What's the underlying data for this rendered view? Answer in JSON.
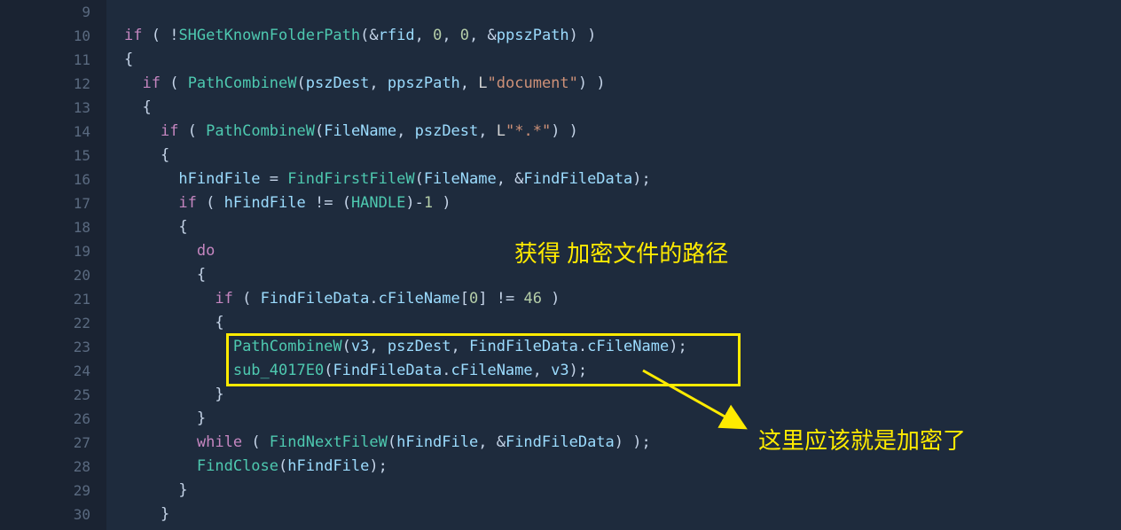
{
  "lines": [
    {
      "num": "9",
      "bp": false,
      "tokens": []
    },
    {
      "num": "10",
      "bp": true,
      "tokens": [
        {
          "t": "if",
          "c": "kw"
        },
        {
          "t": " ( !",
          "c": "punc"
        },
        {
          "t": "SHGetKnownFolderPath",
          "c": "func"
        },
        {
          "t": "(&",
          "c": "punc"
        },
        {
          "t": "rfid",
          "c": "var"
        },
        {
          "t": ", ",
          "c": "punc"
        },
        {
          "t": "0",
          "c": "num"
        },
        {
          "t": ", ",
          "c": "punc"
        },
        {
          "t": "0",
          "c": "num"
        },
        {
          "t": ", &",
          "c": "punc"
        },
        {
          "t": "ppszPath",
          "c": "var"
        },
        {
          "t": ") )",
          "c": "punc"
        }
      ]
    },
    {
      "num": "11",
      "bp": false,
      "tokens": [
        {
          "t": "{",
          "c": "punc"
        }
      ]
    },
    {
      "num": "12",
      "bp": true,
      "tokens": [
        {
          "t": "  ",
          "c": "punc"
        },
        {
          "t": "if",
          "c": "kw"
        },
        {
          "t": " ( ",
          "c": "punc"
        },
        {
          "t": "PathCombineW",
          "c": "func"
        },
        {
          "t": "(",
          "c": "punc"
        },
        {
          "t": "pszDest",
          "c": "var"
        },
        {
          "t": ", ",
          "c": "punc"
        },
        {
          "t": "ppszPath",
          "c": "var"
        },
        {
          "t": ", ",
          "c": "punc"
        },
        {
          "t": "L",
          "c": "strprefix"
        },
        {
          "t": "\"document\"",
          "c": "str"
        },
        {
          "t": ") )",
          "c": "punc"
        }
      ]
    },
    {
      "num": "13",
      "bp": false,
      "tokens": [
        {
          "t": "  {",
          "c": "punc"
        }
      ]
    },
    {
      "num": "14",
      "bp": true,
      "tokens": [
        {
          "t": "    ",
          "c": "punc"
        },
        {
          "t": "if",
          "c": "kw"
        },
        {
          "t": " ( ",
          "c": "punc"
        },
        {
          "t": "PathCombineW",
          "c": "func"
        },
        {
          "t": "(",
          "c": "punc"
        },
        {
          "t": "FileName",
          "c": "var"
        },
        {
          "t": ", ",
          "c": "punc"
        },
        {
          "t": "pszDest",
          "c": "var"
        },
        {
          "t": ", ",
          "c": "punc"
        },
        {
          "t": "L",
          "c": "strprefix"
        },
        {
          "t": "\"*.*\"",
          "c": "str"
        },
        {
          "t": ") )",
          "c": "punc"
        }
      ]
    },
    {
      "num": "15",
      "bp": false,
      "tokens": [
        {
          "t": "    {",
          "c": "punc"
        }
      ]
    },
    {
      "num": "16",
      "bp": true,
      "tokens": [
        {
          "t": "      ",
          "c": "punc"
        },
        {
          "t": "hFindFile",
          "c": "var"
        },
        {
          "t": " = ",
          "c": "op"
        },
        {
          "t": "FindFirstFileW",
          "c": "func"
        },
        {
          "t": "(",
          "c": "punc"
        },
        {
          "t": "FileName",
          "c": "var"
        },
        {
          "t": ", &",
          "c": "punc"
        },
        {
          "t": "FindFileData",
          "c": "var"
        },
        {
          "t": ");",
          "c": "punc"
        }
      ]
    },
    {
      "num": "17",
      "bp": true,
      "tokens": [
        {
          "t": "      ",
          "c": "punc"
        },
        {
          "t": "if",
          "c": "kw"
        },
        {
          "t": " ( ",
          "c": "punc"
        },
        {
          "t": "hFindFile",
          "c": "var"
        },
        {
          "t": " != (",
          "c": "op"
        },
        {
          "t": "HANDLE",
          "c": "type"
        },
        {
          "t": ")-",
          "c": "punc"
        },
        {
          "t": "1",
          "c": "num"
        },
        {
          "t": " )",
          "c": "punc"
        }
      ]
    },
    {
      "num": "18",
      "bp": false,
      "tokens": [
        {
          "t": "      {",
          "c": "punc"
        }
      ]
    },
    {
      "num": "19",
      "bp": false,
      "tokens": [
        {
          "t": "        ",
          "c": "punc"
        },
        {
          "t": "do",
          "c": "kw"
        }
      ]
    },
    {
      "num": "20",
      "bp": false,
      "tokens": [
        {
          "t": "        {",
          "c": "punc"
        }
      ]
    },
    {
      "num": "21",
      "bp": true,
      "tokens": [
        {
          "t": "          ",
          "c": "punc"
        },
        {
          "t": "if",
          "c": "kw"
        },
        {
          "t": " ( ",
          "c": "punc"
        },
        {
          "t": "FindFileData",
          "c": "var"
        },
        {
          "t": ".",
          "c": "punc"
        },
        {
          "t": "cFileName",
          "c": "var"
        },
        {
          "t": "[",
          "c": "punc"
        },
        {
          "t": "0",
          "c": "num"
        },
        {
          "t": "] != ",
          "c": "op"
        },
        {
          "t": "46",
          "c": "num"
        },
        {
          "t": " )",
          "c": "punc"
        }
      ]
    },
    {
      "num": "22",
      "bp": false,
      "tokens": [
        {
          "t": "          {",
          "c": "punc"
        }
      ]
    },
    {
      "num": "23",
      "bp": true,
      "tokens": [
        {
          "t": "            ",
          "c": "punc"
        },
        {
          "t": "PathCombineW",
          "c": "func"
        },
        {
          "t": "(",
          "c": "punc"
        },
        {
          "t": "v3",
          "c": "var"
        },
        {
          "t": ", ",
          "c": "punc"
        },
        {
          "t": "pszDest",
          "c": "var"
        },
        {
          "t": ", ",
          "c": "punc"
        },
        {
          "t": "FindFileData",
          "c": "var"
        },
        {
          "t": ".",
          "c": "punc"
        },
        {
          "t": "cFileName",
          "c": "var"
        },
        {
          "t": ");",
          "c": "punc"
        }
      ]
    },
    {
      "num": "24",
      "bp": true,
      "tokens": [
        {
          "t": "            ",
          "c": "punc"
        },
        {
          "t": "sub_4017E0",
          "c": "func"
        },
        {
          "t": "(",
          "c": "punc"
        },
        {
          "t": "FindFileData",
          "c": "var"
        },
        {
          "t": ".",
          "c": "punc"
        },
        {
          "t": "cFileName",
          "c": "var"
        },
        {
          "t": ", ",
          "c": "punc"
        },
        {
          "t": "v3",
          "c": "var"
        },
        {
          "t": ");",
          "c": "punc"
        }
      ]
    },
    {
      "num": "25",
      "bp": false,
      "tokens": [
        {
          "t": "          }",
          "c": "punc"
        }
      ]
    },
    {
      "num": "26",
      "bp": false,
      "tokens": [
        {
          "t": "        }",
          "c": "punc"
        }
      ]
    },
    {
      "num": "27",
      "bp": true,
      "tokens": [
        {
          "t": "        ",
          "c": "punc"
        },
        {
          "t": "while",
          "c": "kw"
        },
        {
          "t": " ( ",
          "c": "punc"
        },
        {
          "t": "FindNextFileW",
          "c": "func"
        },
        {
          "t": "(",
          "c": "punc"
        },
        {
          "t": "hFindFile",
          "c": "var"
        },
        {
          "t": ", &",
          "c": "punc"
        },
        {
          "t": "FindFileData",
          "c": "var"
        },
        {
          "t": ") );",
          "c": "punc"
        }
      ]
    },
    {
      "num": "28",
      "bp": true,
      "tokens": [
        {
          "t": "        ",
          "c": "punc"
        },
        {
          "t": "FindClose",
          "c": "func"
        },
        {
          "t": "(",
          "c": "punc"
        },
        {
          "t": "hFindFile",
          "c": "var"
        },
        {
          "t": ");",
          "c": "punc"
        }
      ]
    },
    {
      "num": "29",
      "bp": false,
      "tokens": [
        {
          "t": "      }",
          "c": "punc"
        }
      ]
    },
    {
      "num": "30",
      "bp": false,
      "tokens": [
        {
          "t": "    }",
          "c": "punc"
        }
      ]
    }
  ],
  "annotations": {
    "a1": "获得 加密文件的路径",
    "a2": "这里应该就是加密了"
  }
}
